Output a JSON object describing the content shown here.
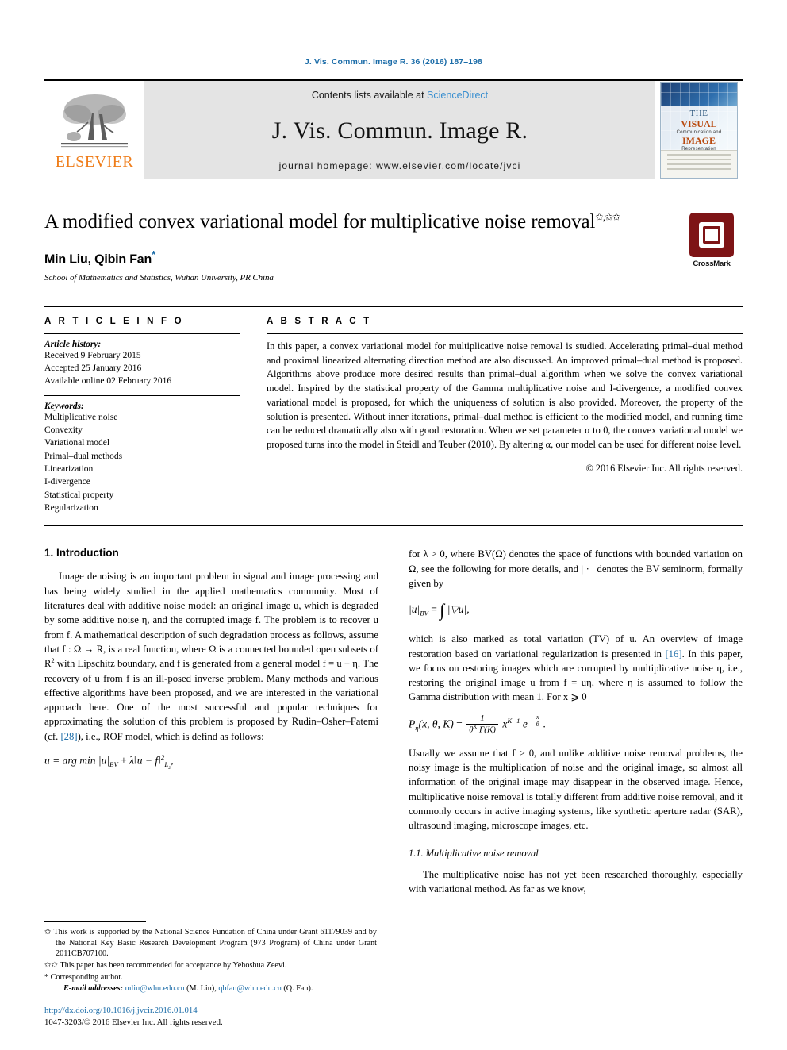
{
  "running_head": "J. Vis. Commun. Image R. 36 (2016) 187–198",
  "masthead": {
    "contents_prefix": "Contents lists available at ",
    "contents_link": "ScienceDirect",
    "journal_name": "J. Vis. Commun. Image R.",
    "homepage": "journal homepage: www.elsevier.com/locate/jvci",
    "publisher_logo_text": "ELSEVIER",
    "cover": {
      "line1": "THE",
      "line2": "VISUAL",
      "line3": "Communication and",
      "line4": "IMAGE",
      "line5": "Representation"
    }
  },
  "article": {
    "title": "A modified convex variational model for multiplicative noise removal",
    "title_footnote_marks": "✩,✩✩",
    "authors": "Min Liu, Qibin Fan",
    "corresponding_mark": "*",
    "affiliation": "School of Mathematics and Statistics, Wuhan University, PR China"
  },
  "crossmark": {
    "label": "CrossMark"
  },
  "article_info": {
    "heading": "A R T I C L E    I N F O",
    "history_label": "Article history:",
    "history": [
      "Received 9 February 2015",
      "Accepted 25 January 2016",
      "Available online 02 February 2016"
    ],
    "keywords_label": "Keywords:",
    "keywords": [
      "Multiplicative noise",
      "Convexity",
      "Variational model",
      "Primal–dual methods",
      "Linearization",
      "I-divergence",
      "Statistical property",
      "Regularization"
    ]
  },
  "abstract": {
    "heading": "A B S T R A C T",
    "text": "In this paper, a convex variational model for multiplicative noise removal is studied. Accelerating primal–dual method and proximal linearized alternating direction method are also discussed. An improved primal–dual method is proposed. Algorithms above produce more desired results than primal–dual algorithm when we solve the convex variational model. Inspired by the statistical property of the Gamma multiplicative noise and I-divergence, a modified convex variational model is proposed, for which the uniqueness of solution is also provided. Moreover, the property of the solution is presented. Without inner iterations, primal–dual method is efficient to the modified model, and running time can be reduced dramatically also with good restoration. When we set parameter α to 0, the convex variational model we proposed turns into the model in Steidl and Teuber (2010). By altering α, our model can be used for different noise level.",
    "copyright": "© 2016 Elsevier Inc. All rights reserved."
  },
  "sections": {
    "intro_heading": "1. Introduction",
    "intro_p1_a": "Image denoising is an important problem in signal and image processing and has being widely studied in the applied mathematics community. Most of literatures deal with additive noise model: an original image u, which is degraded by some additive noise η, and the corrupted image f. The problem is to recover u from f. A mathematical description of such degradation process as follows, assume that f : Ω → R, is a real function, where Ω is a connected bounded open subsets of R",
    "intro_p1_b": " with Lipschitz boundary, and f is generated from a general model f = u + η. The recovery of u from f is an ill-posed inverse problem. Many methods and various effective algorithms have been proposed, and we are interested in the variational approach here. One of the most successful and popular techniques for approximating the solution of this problem is proposed by Rudin–Osher–Fatemi (cf. ",
    "intro_p1_ref": "[28]",
    "intro_p1_c": "), i.e., ROF model, which is defind as follows:",
    "eq_rof": "u = arg min |u|",
    "right_p1": "for λ > 0, where BV(Ω) denotes the space of functions with bounded variation on Ω, see the following for more details, and | · | denotes the BV seminorm, formally given by",
    "right_p2_a": "which is also marked as total variation (TV) of u. An overview of image restoration based on variational regularization is presented in ",
    "right_p2_ref": "[16]",
    "right_p2_b": ". In this paper, we focus on restoring images which are corrupted by multiplicative noise η, i.e., restoring the original image u from f = uη, where η is assumed to follow the Gamma distribution with mean 1. For x ⩾ 0",
    "right_p3": "Usually we assume that f > 0, and unlike additive noise removal problems, the noisy image is the multiplication of noise and the original image, so almost all information of the original image may disappear in the observed image. Hence, multiplicative noise removal is totally different from additive noise removal, and it commonly occurs in active imaging systems, like synthetic aperture radar (SAR), ultrasound imaging, microscope images, etc.",
    "subsec_heading": "1.1. Multiplicative noise removal",
    "right_p4": "The multiplicative noise has not yet been researched thoroughly, especially with variational method. As far as we know,"
  },
  "footnotes": {
    "fn1": "✩ This work is supported by the National Science Fundation of China under Grant 61179039 and by the National Key Basic Research Development Program (973 Program) of China under Grant 2011CB707100.",
    "fn2": "✩✩ This paper has been recommended for acceptance by Yehoshua Zeevi.",
    "fn3": "* Corresponding author.",
    "email_label": "E-mail addresses:",
    "email1": "mliu@whu.edu.cn",
    "email1_name": " (M. Liu), ",
    "email2": "qbfan@whu.edu.cn",
    "email2_name": " (Q. Fan).",
    "doi": "http://dx.doi.org/10.1016/j.jvcir.2016.01.014",
    "issn": "1047-3203/© 2016 Elsevier Inc. All rights reserved."
  },
  "colors": {
    "link": "#1b6ca8",
    "elsevier_orange": "#ef7d1a",
    "crossmark_red": "#7e1416",
    "masthead_gray": "#e4e4e4"
  }
}
